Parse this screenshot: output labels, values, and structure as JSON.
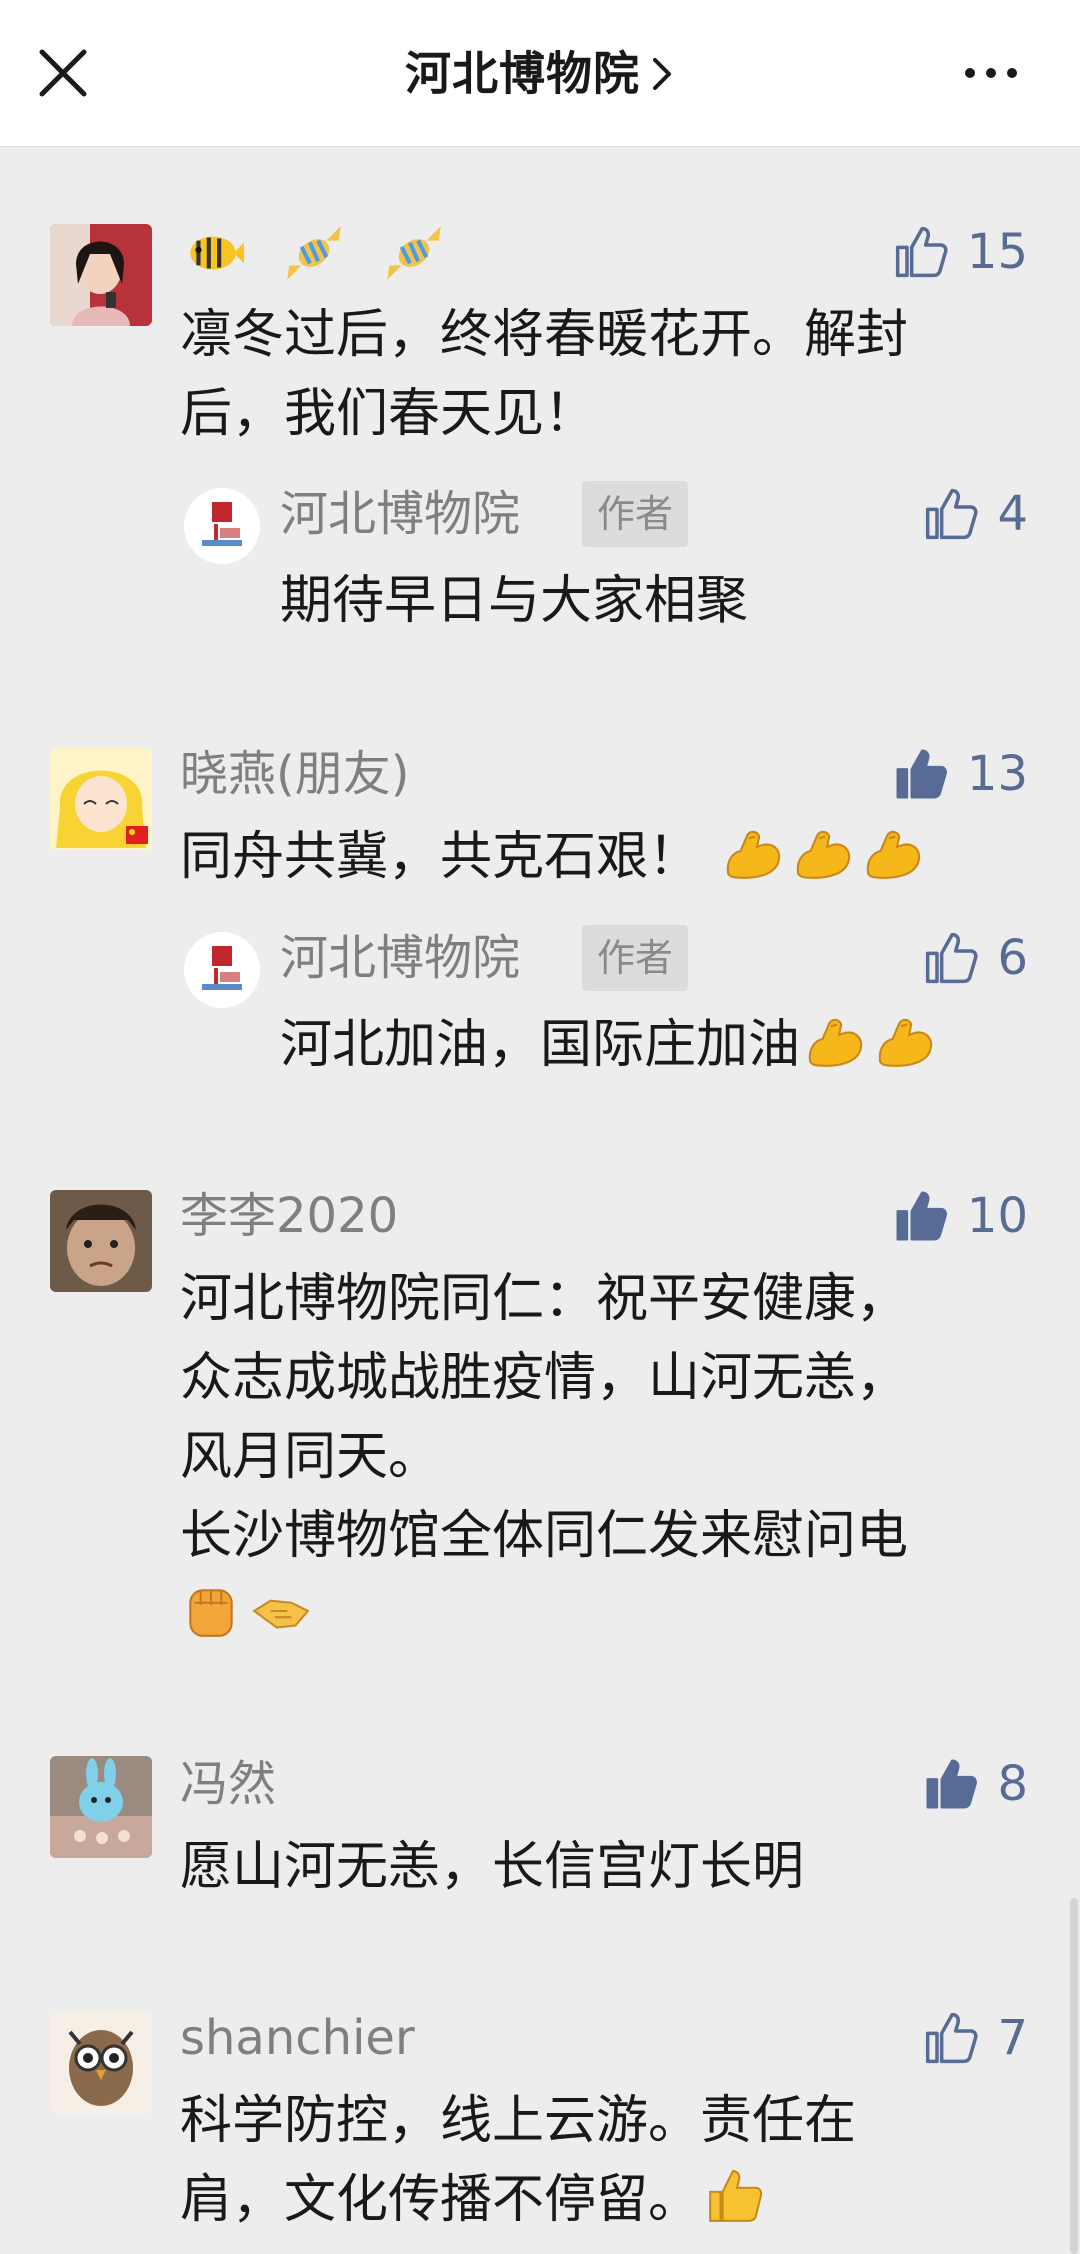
{
  "header": {
    "title": "河北博物院",
    "icons": {
      "close": "close-icon",
      "chevron": "chevron-right-icon",
      "more": "more-dots-icon"
    }
  },
  "colors": {
    "like_blue": "#576b95",
    "nick_gray": "#7f7f7f",
    "bg": "#ededed"
  },
  "comments": [
    {
      "nickname_emojis": [
        "tropical-fish-emoji",
        "candy-emoji",
        "candy-emoji"
      ],
      "likes": "15",
      "liked": false,
      "text_lines": [
        "凛冬过后，终将春暖花开。解封",
        "后，我们春天见！"
      ],
      "reply": {
        "nickname": "河北博物院",
        "badge": "作者",
        "likes": "4",
        "text": "期待早日与大家相聚"
      }
    },
    {
      "nickname": "晓燕(朋友)",
      "likes": "13",
      "liked": true,
      "text": "同舟共冀，共克石艰！",
      "text_emojis": [
        "flexed-biceps-emoji",
        "flexed-biceps-emoji",
        "flexed-biceps-emoji"
      ],
      "reply": {
        "nickname": "河北博物院",
        "badge": "作者",
        "likes": "6",
        "text": "河北加油，国际庄加油",
        "text_emojis": [
          "flexed-biceps-emoji",
          "flexed-biceps-emoji"
        ]
      }
    },
    {
      "nickname": "李李2020",
      "likes": "10",
      "liked": true,
      "text_lines": [
        "河北博物院同仁：祝平安健康，",
        "众志成城战胜疫情，山河无恙，",
        "风月同天。",
        "长沙博物馆全体同仁发来慰问电"
      ],
      "text_emojis": [
        "raised-fist-emoji",
        "handshake-emoji"
      ]
    },
    {
      "nickname": "冯然",
      "likes": "8",
      "liked": true,
      "text": "愿山河无恙，长信宫灯长明"
    },
    {
      "nickname": "shanchier",
      "likes": "7",
      "liked": false,
      "text_lines": [
        "科学防控，线上云游。责任在",
        "肩，文化传播不停留。"
      ],
      "text_emojis": [
        "thumbs-up-emoji"
      ]
    }
  ]
}
